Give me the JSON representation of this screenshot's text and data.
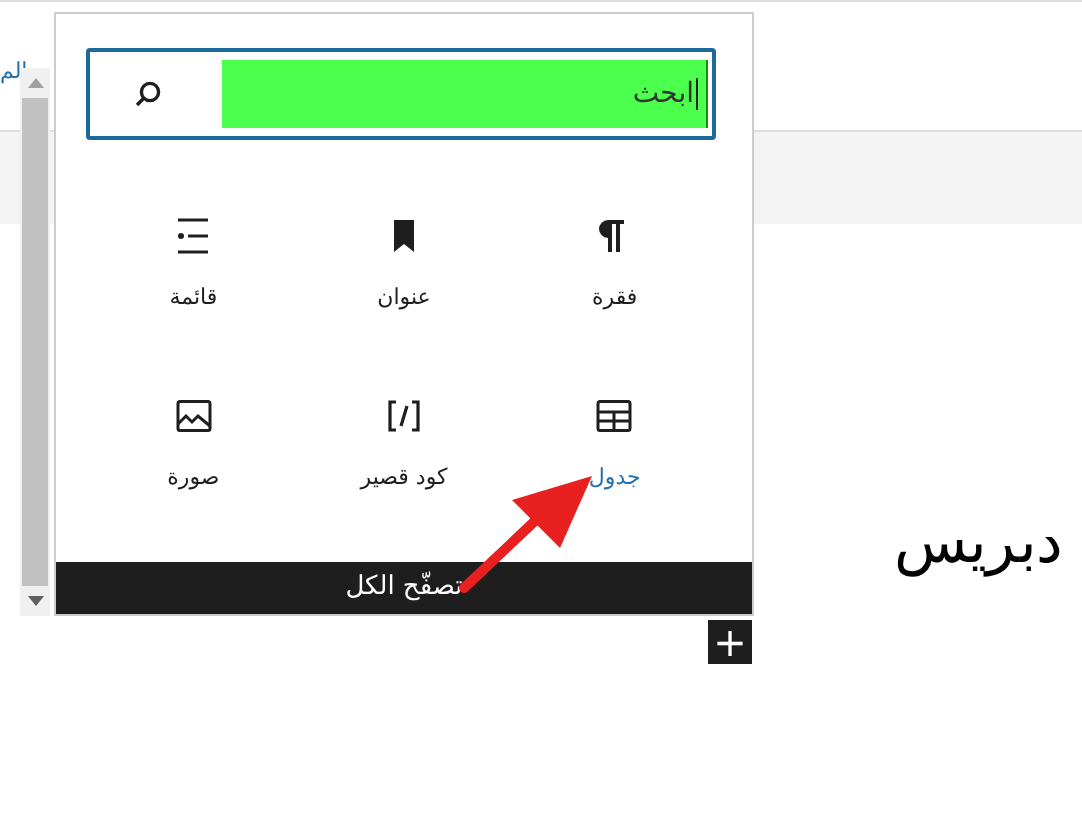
{
  "page": {
    "top_link": "الم",
    "heading": "دبريس",
    "add_button": "+"
  },
  "inserter": {
    "search": {
      "value": "ابحث"
    },
    "blocks": [
      {
        "label": "فقرة",
        "kind": "paragraph",
        "selected": false
      },
      {
        "label": "عنوان",
        "kind": "heading",
        "selected": false
      },
      {
        "label": "قائمة",
        "kind": "list",
        "selected": false
      },
      {
        "label": "جدول",
        "kind": "table",
        "selected": true
      },
      {
        "label": "كود قصير",
        "kind": "shortcode",
        "selected": false
      },
      {
        "label": "صورة",
        "kind": "image",
        "selected": false
      }
    ],
    "browse_all": "تصفّح الكل"
  }
}
